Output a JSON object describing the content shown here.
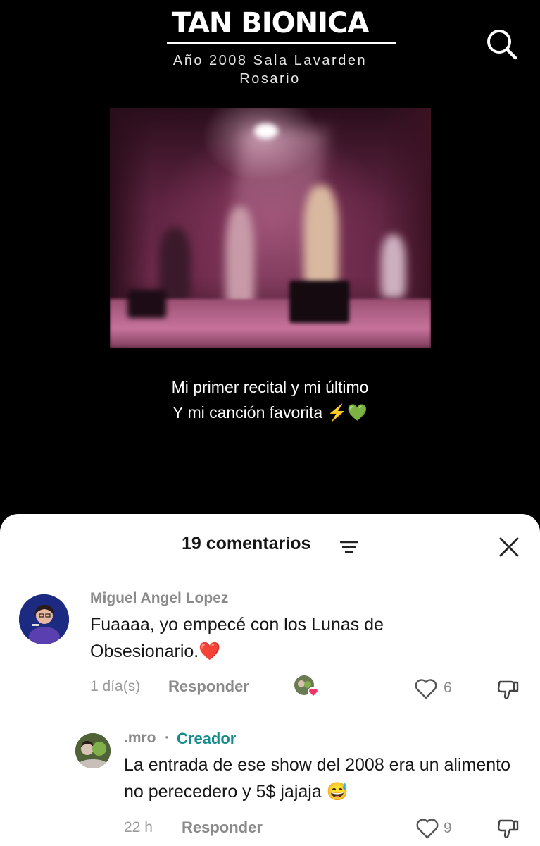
{
  "video": {
    "title": "TAN BIONICA",
    "subtitle_line1": "Año 2008 Sala Lavarden",
    "subtitle_line2": "Rosario",
    "caption_line1": "Mi primer recital y mi último",
    "caption_line2": "Y mi canción favorita ⚡💚"
  },
  "comments_panel": {
    "count_label": "19 comentarios",
    "filter_icon": "sort-lines-icon",
    "close_icon": "close-icon",
    "comments": [
      {
        "username": "Miguel Angel Lopez",
        "text": "Fuaaaa, yo empecé con los Lunas de Obsesionario.❤️",
        "time": "1 día(s)",
        "reply_label": "Responder",
        "likes": "6",
        "liked_by_creator": true
      },
      {
        "username": ".mro",
        "separator": "·",
        "badge": "Creador",
        "text": "La entrada de ese show del 2008 era un alimento no perecedero y 5$ jajaja 😅",
        "time": "22 h",
        "reply_label": "Responder",
        "likes": "9"
      }
    ]
  },
  "colors": {
    "creator_badge": "#178c8c",
    "heart_badge": "#f0346a",
    "sheet_bg": "#ffffff"
  }
}
